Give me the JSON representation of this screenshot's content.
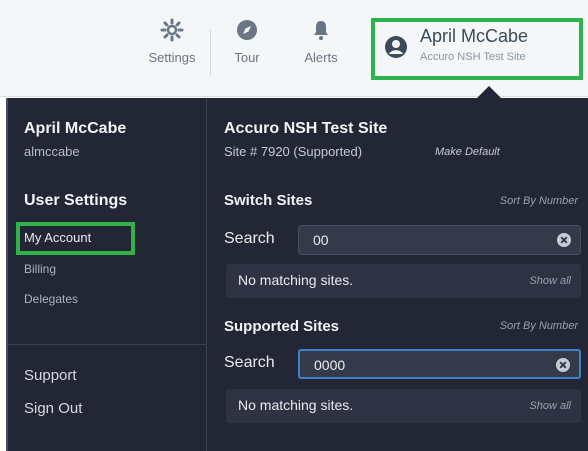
{
  "topbar": {
    "settings_label": "Settings",
    "settings_icon": "gear-icon",
    "tour_label": "Tour",
    "tour_icon": "compass-icon",
    "alerts_label": "Alerts",
    "alerts_icon": "bell-icon",
    "user_icon": "user-circle-icon",
    "user_name": "April McCabe",
    "user_site": "Accuro NSH Test Site"
  },
  "user_menu": {
    "name": "April McCabe",
    "username": "almccabe",
    "settings_heading": "User Settings",
    "links": [
      "My Account",
      "Billing",
      "Delegates"
    ],
    "support": "Support",
    "sign_out": "Sign Out"
  },
  "site": {
    "title": "Accuro NSH Test Site",
    "number": "Site # 7920 (Supported)",
    "make_default": "Make Default"
  },
  "switch_sites": {
    "heading": "Switch Sites",
    "sort_label": "Sort By Number",
    "search_label": "Search",
    "search_value": "00",
    "result": "No matching sites.",
    "show_all": "Show all"
  },
  "supported_sites": {
    "heading": "Supported Sites",
    "sort_label": "Sort By Number",
    "search_label": "Search",
    "search_value": "0000",
    "result": "No matching sites.",
    "show_all": "Show all"
  },
  "colors": {
    "highlight": "#2fb34a",
    "panel_bg": "#232634",
    "topbar_bg": "#f4f6f8",
    "focus": "#3f7fd0"
  }
}
